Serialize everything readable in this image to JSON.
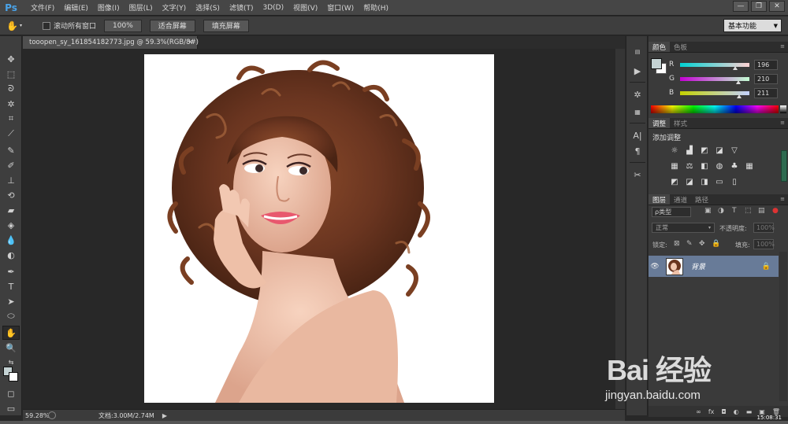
{
  "app": {
    "logo": "Ps"
  },
  "menu": [
    "文件(F)",
    "编辑(E)",
    "图像(I)",
    "图层(L)",
    "文字(Y)",
    "选择(S)",
    "滤镜(T)",
    "3D(D)",
    "视图(V)",
    "窗口(W)",
    "帮助(H)"
  ],
  "window_buttons": [
    "—",
    "❐",
    "✕"
  ],
  "options": {
    "scroll_all_label": "滚动所有窗口",
    "btn_100": "100%",
    "btn_fit": "适合屏幕",
    "btn_fill": "填充屏幕",
    "workspace": "基本功能"
  },
  "document": {
    "tab_title": "tooopen_sy_161854182773.jpg @ 59.3%(RGB/8#)",
    "tab_close": "×"
  },
  "status": {
    "zoom": "59.28%",
    "doc_info": "文档:3.00M/2.74M"
  },
  "color_panel": {
    "tabs": [
      "颜色",
      "色板"
    ],
    "foreground": "#c4d2d3",
    "channels": [
      {
        "label": "R",
        "value": "196",
        "fraction": 0.77
      },
      {
        "label": "G",
        "value": "210",
        "fraction": 0.82
      },
      {
        "label": "B",
        "value": "211",
        "fraction": 0.83
      }
    ]
  },
  "adjust_panel": {
    "tabs": [
      "调整",
      "样式"
    ],
    "title": "添加调整"
  },
  "layers_panel": {
    "tabs": [
      "图层",
      "通道",
      "路径"
    ],
    "filter": "ρ类型",
    "blend_mode": "正常",
    "opacity_label": "不透明度:",
    "opacity_value": "100%",
    "lock_label": "锁定:",
    "fill_label": "填充:",
    "fill_value": "100%",
    "layer": {
      "name": "背景"
    }
  },
  "watermark": {
    "main": "Bai 经验",
    "sub": "jingyan.baidu.com"
  },
  "time": "15:08:31"
}
